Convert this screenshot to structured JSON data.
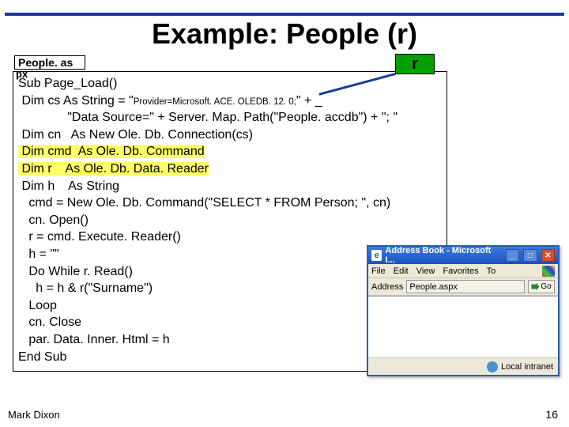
{
  "title": "Example: People (r)",
  "file_label": "People. as",
  "file_label_ext": "px",
  "r_label": "r",
  "code": {
    "l1": "Sub Page_Load()",
    "l2a": " Dim cs As String = \"",
    "l2b": "Provider=Microsoft. ACE. OLEDB. 12. 0;",
    "l2c": "\" + _",
    "l3": "              \"Data Source=\" + Server. Map. Path(\"People. accdb\") + \"; \"",
    "l4": " Dim cn   As New Ole. Db. Connection(cs)",
    "l5": " Dim cmd  As Ole. Db. Command",
    "l6": " Dim r    As Ole. Db. Data. Reader",
    "l7": " Dim h    As String",
    "l8": "   cmd = New Ole. Db. Command(\"SELECT * FROM Person; \", cn)",
    "l9": "   cn. Open()",
    "l10": "   r = cmd. Execute. Reader()",
    "l11": "   h = \"\"",
    "l12": "   Do While r. Read()",
    "l13": "     h = h & r(\"Surname\")",
    "l14": "   Loop",
    "l15": "   cn. Close",
    "l16": "   par. Data. Inner. Html = h",
    "l17": "End Sub"
  },
  "ie": {
    "title": "Address Book - Microsoft I...",
    "menu": [
      "File",
      "Edit",
      "View",
      "Favorites",
      "To"
    ],
    "addr_label": "Address",
    "addr_value": "People.aspx",
    "go": "Go",
    "status": "Local intranet"
  },
  "footer": {
    "author": "Mark Dixon",
    "page": "16"
  }
}
